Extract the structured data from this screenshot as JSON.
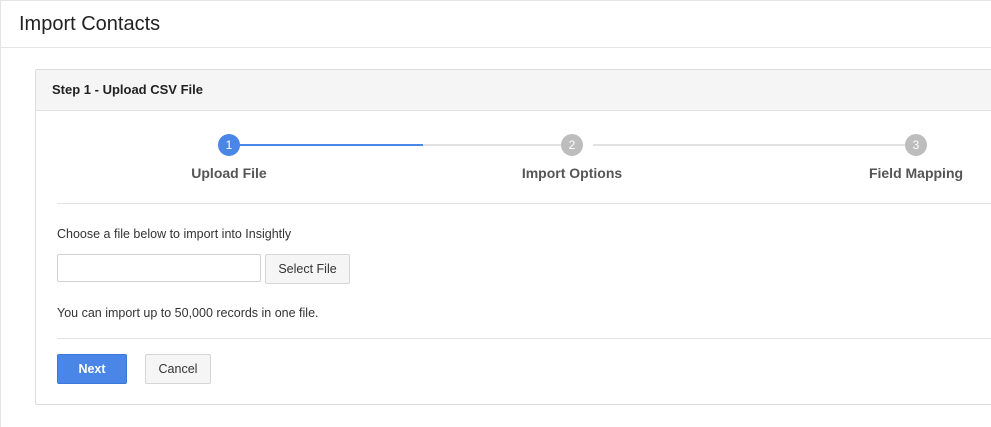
{
  "page": {
    "title": "Import Contacts"
  },
  "panel": {
    "heading": "Step 1 - Upload CSV File"
  },
  "stepper": {
    "steps": [
      {
        "number": "1",
        "label": "Upload File",
        "active": true
      },
      {
        "number": "2",
        "label": "Import Options",
        "active": false
      },
      {
        "number": "3",
        "label": "Field Mapping",
        "active": false
      }
    ]
  },
  "upload": {
    "instruction": "Choose a file below to import into Insightly",
    "file_value": "",
    "select_label": "Select File",
    "limit_text": "You can import up to 50,000 records in one file."
  },
  "actions": {
    "next_label": "Next",
    "cancel_label": "Cancel"
  },
  "colors": {
    "accent": "#4a86e8",
    "inactive_step": "#bdbdbd"
  }
}
